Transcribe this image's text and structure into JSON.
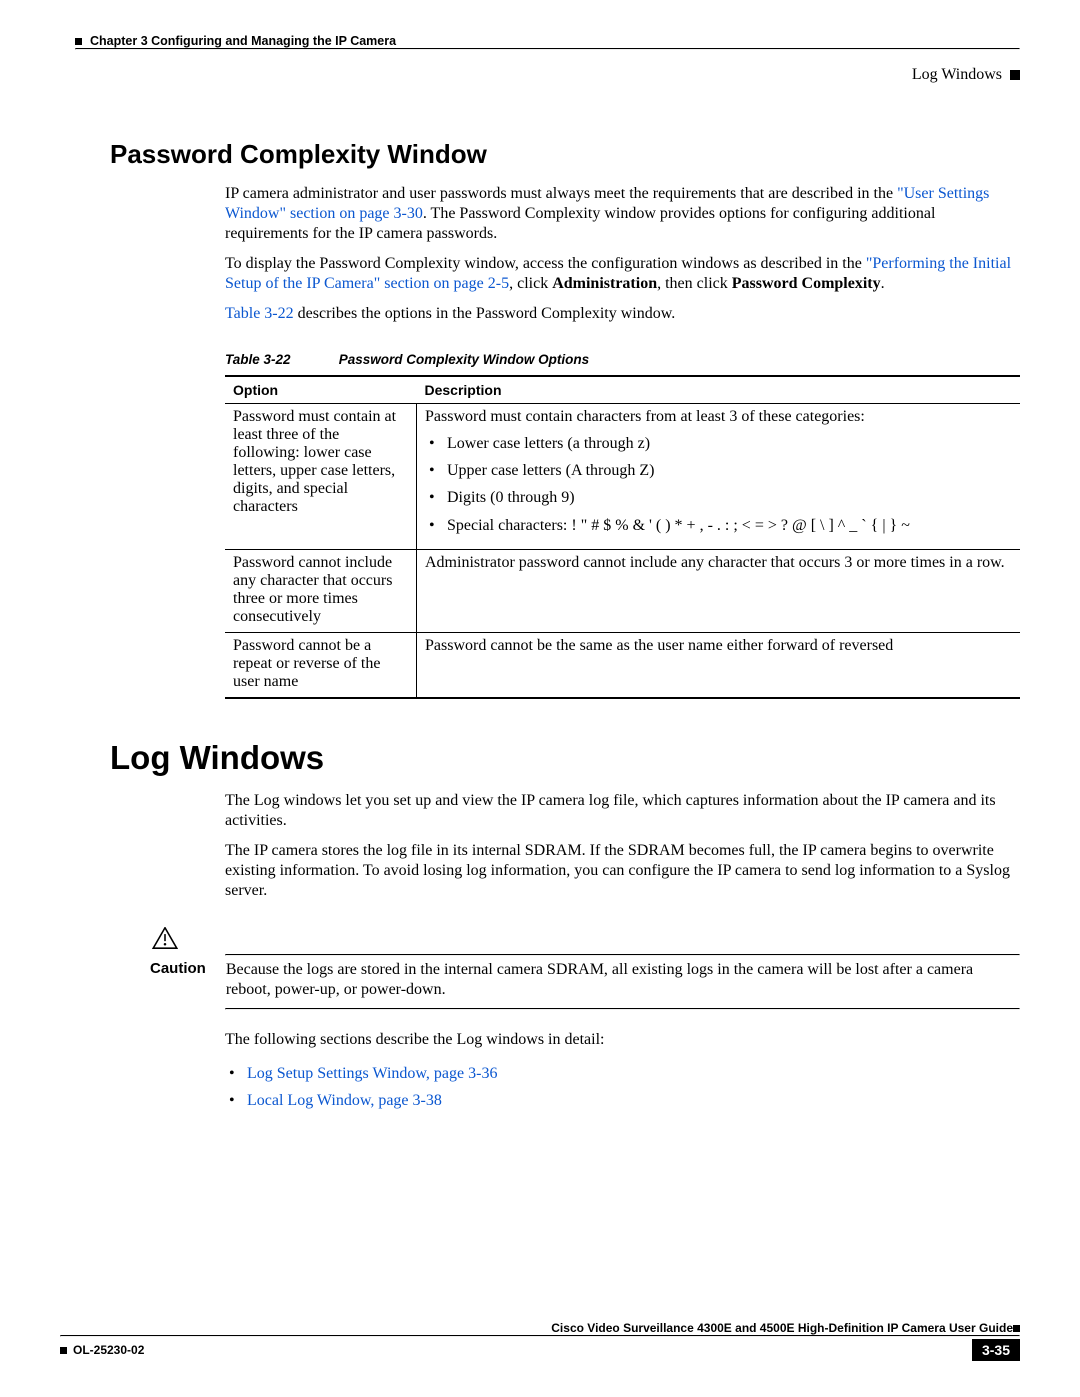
{
  "header": {
    "chapter": "Chapter 3      Configuring and Managing the IP Camera",
    "section": "Log Windows"
  },
  "pwc": {
    "title": "Password Complexity Window",
    "p1a": "IP camera administrator and user passwords must always meet the requirements that are described in the ",
    "link1": "\"User Settings Window\" section on page 3-30",
    "p1b": ". The Password Complexity window provides options for configuring additional requirements for the IP camera passwords.",
    "p2a": "To display the Password Complexity window, access the configuration windows as described in the ",
    "link2": "\"Performing the Initial Setup of the IP Camera\" section on page 2-5",
    "p2b": ", click ",
    "admin": "Administration",
    "p2c": ", then click ",
    "pc": "Password Complexity",
    "p2d": ".",
    "p3a": "Table 3-22",
    "p3b": " describes the options in the Password Complexity window.",
    "table_caption_num": "Table 3-22",
    "table_caption_title": "Password Complexity Window Options",
    "th1": "Option",
    "th2": "Description",
    "r1c1": "Password must contain at least three of the following: lower case letters, upper case letters, digits, and special characters",
    "r1c2_lead": "Password must contain characters from at least 3 of these categories:",
    "r1c2_b1": "Lower case letters (a through z)",
    "r1c2_b2": "Upper case letters (A through Z)",
    "r1c2_b3": "Digits (0 through 9)",
    "r1c2_b4": "Special characters: ! \" # $ % & ' ( ) * + , - . : ; < = > ? @ [ \\ ] ^ _ ` { | } ~",
    "r2c1": "Password cannot include any character that occurs three or more times consecutively",
    "r2c2": "Administrator password cannot include any character that occurs 3 or more times in a row.",
    "r3c1": "Password cannot be a repeat or reverse of the user name",
    "r3c2": "Password cannot be the same as the user name either forward of reversed"
  },
  "log": {
    "title": "Log Windows",
    "p1": "The Log windows let you set up and view the IP camera log file, which captures information about the IP camera and its activities.",
    "p2": "The IP camera stores the log file in its internal SDRAM. If the SDRAM becomes full, the IP camera begins to overwrite existing information. To avoid losing log information, you can configure the IP camera to send log information to a Syslog server.",
    "caution_label": "Caution",
    "caution_text": "Because the logs are stored in the internal camera SDRAM, all existing logs in the camera will be lost after a camera reboot, power-up, or power-down.",
    "p3": "The following sections describe the Log windows in detail:",
    "link1": "Log Setup Settings Window, page 3-36",
    "link2": "Local Log Window, page 3-38"
  },
  "footer": {
    "book": "Cisco Video Surveillance 4300E and 4500E High-Definition IP Camera User Guide",
    "doc": "OL-25230-02",
    "page": "3-35"
  }
}
